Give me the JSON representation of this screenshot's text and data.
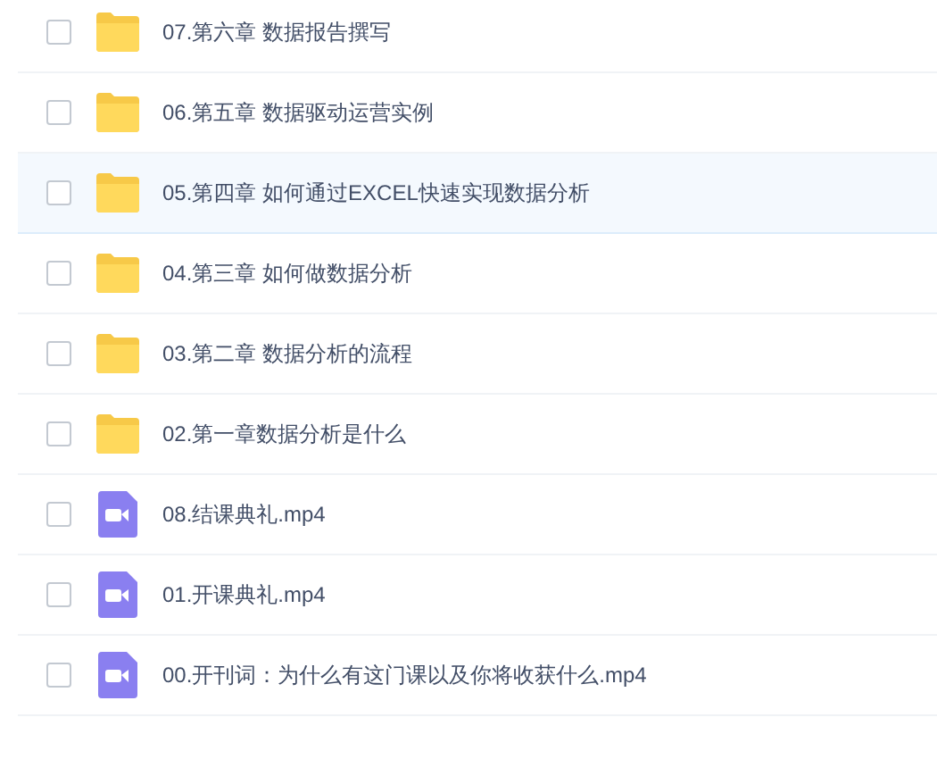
{
  "files": [
    {
      "kind": "folder",
      "name": "07.第六章 数据报告撰写",
      "checked": false,
      "highlighted": false
    },
    {
      "kind": "folder",
      "name": "06.第五章 数据驱动运营实例",
      "checked": false,
      "highlighted": false
    },
    {
      "kind": "folder",
      "name": "05.第四章 如何通过EXCEL快速实现数据分析",
      "checked": false,
      "highlighted": true
    },
    {
      "kind": "folder",
      "name": "04.第三章 如何做数据分析",
      "checked": false,
      "highlighted": false
    },
    {
      "kind": "folder",
      "name": "03.第二章 数据分析的流程",
      "checked": false,
      "highlighted": false
    },
    {
      "kind": "folder",
      "name": "02.第一章数据分析是什么",
      "checked": false,
      "highlighted": false
    },
    {
      "kind": "video",
      "name": "08.结课典礼.mp4",
      "checked": false,
      "highlighted": false
    },
    {
      "kind": "video",
      "name": "01.开课典礼.mp4",
      "checked": false,
      "highlighted": false
    },
    {
      "kind": "video",
      "name": "00.开刊词：为什么有这门课以及你将收获什么.mp4",
      "checked": false,
      "highlighted": false
    }
  ]
}
